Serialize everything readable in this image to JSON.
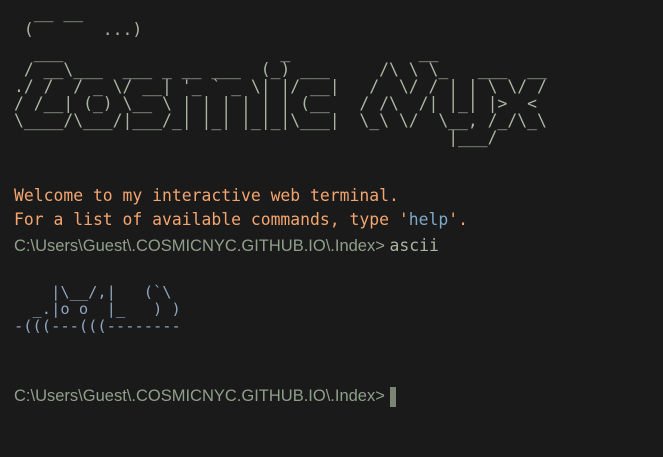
{
  "header": {
    "small_logo": "  __ __\n (       ...)",
    "big_logo": "  ___                      _             __\n / __\\___  ___ _ __ ___  (_) ___     /\\ \\ \\_   ___  __\n./ /  / _ \\/ __| '_ ` _ \\| |/ __|   /  \\/ / | | \\ \\/ /\n/ /__| (_) \\__ \\ | | | | | | (__   / /\\  /| |_| |>  <\n\\____/\\___/|___/_| |_| |_|_|\\___|  \\_\\ \\/  \\__, /_/\\_\\\n                                            |___/"
  },
  "welcome": {
    "line1": "Welcome to my interactive web terminal.",
    "line2_prefix": "For a list of available commands, type ",
    "line2_quote_open": "'",
    "line2_command": "help",
    "line2_quote_close": "'",
    "line2_suffix": "."
  },
  "history": {
    "prompt": "C:\\Users\\Guest\\.COSMICNYC.GITHUB.IO\\.Index> ",
    "command": "ascii"
  },
  "ascii_art": "    |\\__/,|   (`\\\n  _.|o o  |_   ) )\n-(((---(((--------",
  "current": {
    "prompt": "C:\\Users\\Guest\\.COSMICNYC.GITHUB.IO\\.Index> ",
    "input_value": ""
  },
  "colors": {
    "background": "#1a1a1a",
    "logo": "#a9b5a3",
    "welcome": "#f3a56f",
    "command_highlight": "#7fa8c9",
    "prompt": "#8fa08a",
    "ascii_art": "#8fa5c0",
    "cursor": "#7a8573"
  }
}
